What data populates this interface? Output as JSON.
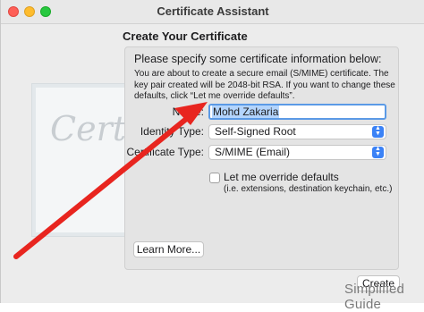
{
  "window": {
    "title": "Certificate Assistant"
  },
  "page": {
    "heading": "Create Your Certificate",
    "prompt": "Please specify some certificate information below:",
    "description": "You are about to create a secure email (S/MIME) certificate. The key pair created will be 2048-bit RSA. If you want to change these defaults, click “Let me override defaults”."
  },
  "form": {
    "name_label": "Name:",
    "name_value": "Mohd Zakaria",
    "identity_type_label": "Identity Type:",
    "identity_type_value": "Self-Signed Root",
    "certificate_type_label": "Certificate Type:",
    "certificate_type_value": "S/MIME (Email)",
    "override_label": "Let me override defaults",
    "override_checked": false,
    "override_sub": "(i.e. extensions, destination keychain, etc.)"
  },
  "buttons": {
    "learn_more": "Learn More...",
    "create": "Create"
  },
  "decor": {
    "certificate_script": "Certificate",
    "watermark": "Simplified Guide",
    "arrow_color": "#e8251f"
  }
}
